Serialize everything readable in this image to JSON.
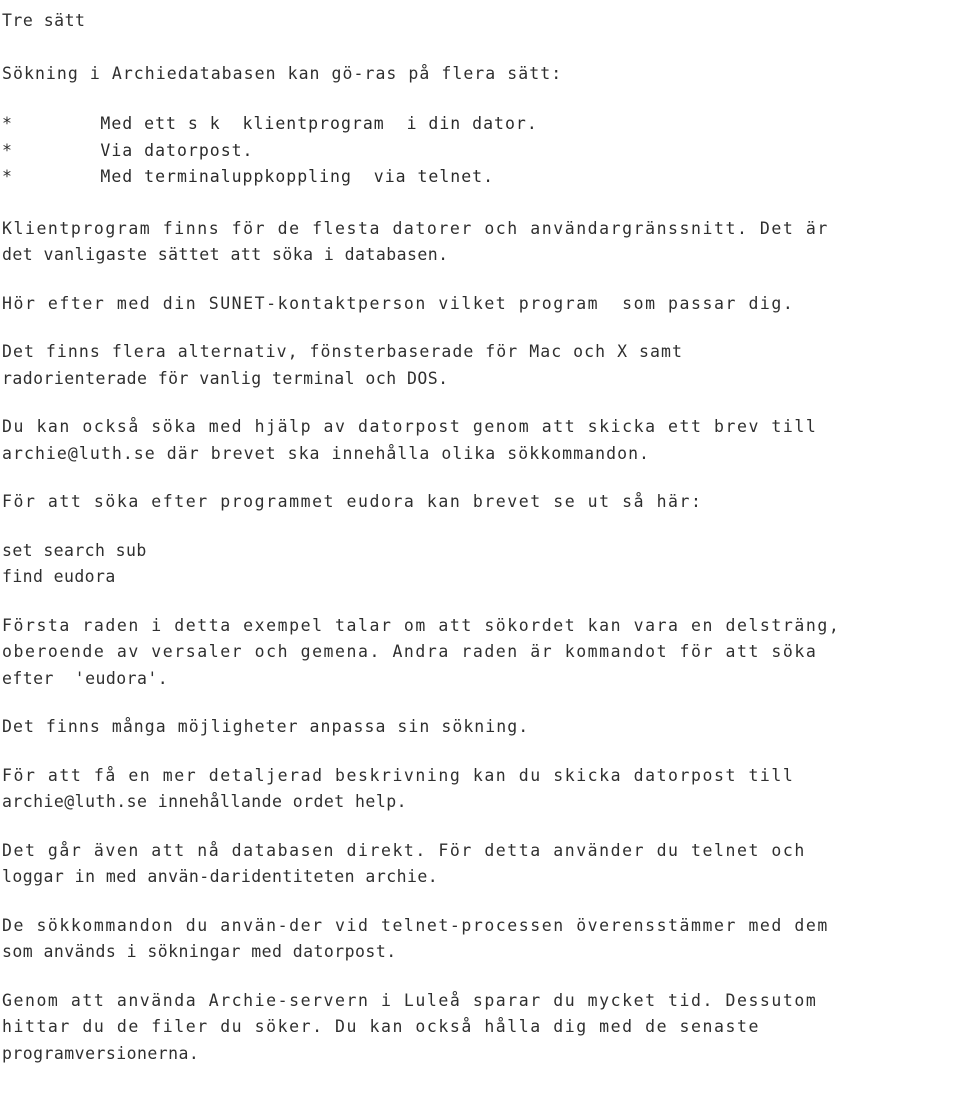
{
  "document": {
    "title": "Tre sätt",
    "language": "sv",
    "blocks": [
      {
        "id": "heading",
        "kind": "heading",
        "lines": [
          "Tre sätt"
        ]
      },
      {
        "id": "intro",
        "kind": "paragraph",
        "lines": [
          "Sökning i Archiedatabasen kan gö-ras på flera sätt:"
        ]
      },
      {
        "id": "bullets",
        "kind": "list",
        "marker": "*",
        "items": [
          "Med ett s k  klientprogram  i din dator.",
          "Via datorpost.",
          "Med terminaluppkoppling  via telnet."
        ]
      },
      {
        "id": "p-klientprogram",
        "kind": "paragraph",
        "lines": [
          "Klientprogram finns för de flesta datorer och användargränssnitt. Det är",
          "det vanligaste sättet att söka i databasen."
        ]
      },
      {
        "id": "p-sunet",
        "kind": "paragraph",
        "lines": [
          "Hör efter med din SUNET-kontaktperson vilket program  som passar dig."
        ]
      },
      {
        "id": "p-alternativ",
        "kind": "paragraph",
        "lines": [
          "Det finns flera alternativ, fönsterbaserade för Mac och X samt",
          "radorienterade för vanlig terminal och DOS."
        ]
      },
      {
        "id": "p-datorpost",
        "kind": "paragraph",
        "lines": [
          "Du kan också söka med hjälp av datorpost genom att skicka ett brev till",
          "archie@luth.se där brevet ska innehålla olika sökkommandon."
        ]
      },
      {
        "id": "p-eudora-intro",
        "kind": "paragraph",
        "lines": [
          "För att söka efter programmet eudora kan brevet se ut så här:"
        ]
      },
      {
        "id": "code-example",
        "kind": "code",
        "lines": [
          "set search sub",
          "find eudora"
        ]
      },
      {
        "id": "p-forsta-raden",
        "kind": "paragraph",
        "lines": [
          "Första raden i detta exempel talar om att sökordet kan vara en delsträng,",
          "oberoende av versaler och gemena. Andra raden är kommandot för att söka",
          "efter  'eudora'."
        ]
      },
      {
        "id": "p-mojligheter",
        "kind": "paragraph",
        "lines": [
          "Det finns många möjligheter anpassa sin sökning."
        ]
      },
      {
        "id": "p-help",
        "kind": "paragraph",
        "lines": [
          "För att få en mer detaljerad beskrivning kan du skicka datorpost till",
          "archie@luth.se innehållande ordet help."
        ]
      },
      {
        "id": "p-telnet",
        "kind": "paragraph",
        "lines": [
          "Det går även att nå databasen direkt. För detta använder du telnet och",
          "loggar in med använ-daridentiteten archie."
        ]
      },
      {
        "id": "p-sokkommandon",
        "kind": "paragraph",
        "lines": [
          "De sökkommandon du använ-der vid telnet-processen överensstämmer med dem",
          "som används i sökningar med datorpost."
        ]
      },
      {
        "id": "p-lulea",
        "kind": "paragraph",
        "lines": [
          "Genom att använda Archie-servern i Luleå sparar du mycket tid. Dessutom",
          "hittar du de filer du söker. Du kan också hålla dig med de senaste",
          "programversionerna."
        ]
      }
    ]
  }
}
